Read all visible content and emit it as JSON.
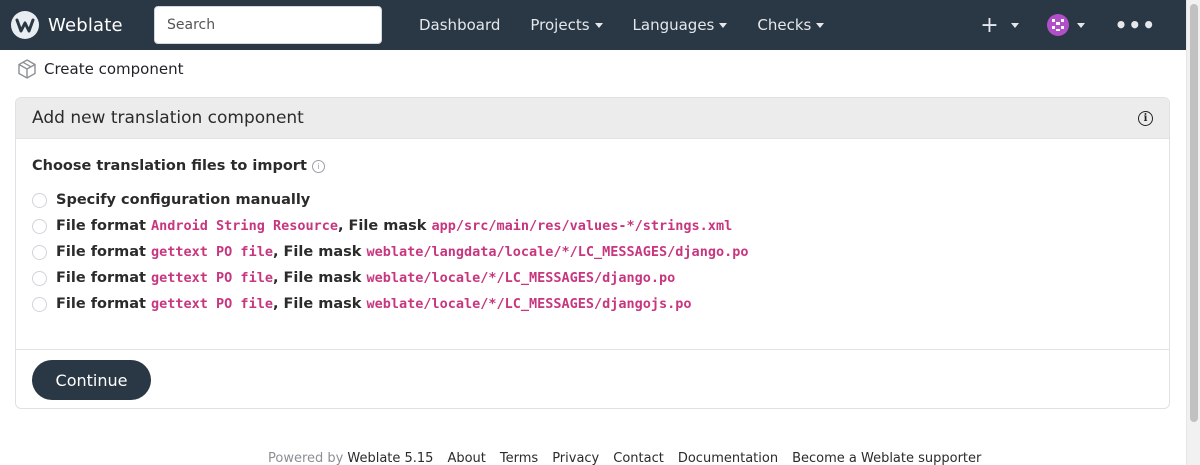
{
  "app": {
    "name": "Weblate"
  },
  "search": {
    "placeholder": "Search"
  },
  "nav": {
    "items": [
      "Dashboard",
      "Projects",
      "Languages",
      "Checks"
    ]
  },
  "navright": {
    "plus": "+",
    "more": "•••"
  },
  "breadcrumb": {
    "label": "Create component"
  },
  "card": {
    "title": "Add new translation component",
    "legend": "Choose translation files to import",
    "options": [
      {
        "plain": "Specify configuration manually"
      },
      {
        "prefix": "File format ",
        "format": "Android String Resource",
        "middle": ", File mask ",
        "mask": "app/src/main/res/values-*/strings.xml"
      },
      {
        "prefix": "File format ",
        "format": "gettext PO file",
        "middle": ", File mask ",
        "mask": "weblate/langdata/locale/*/LC_MESSAGES/django.po"
      },
      {
        "prefix": "File format ",
        "format": "gettext PO file",
        "middle": ", File mask ",
        "mask": "weblate/locale/*/LC_MESSAGES/django.po"
      },
      {
        "prefix": "File format ",
        "format": "gettext PO file",
        "middle": ", File mask ",
        "mask": "weblate/locale/*/LC_MESSAGES/djangojs.po"
      }
    ],
    "continue_label": "Continue"
  },
  "footer": {
    "powered_by": "Powered by",
    "version": "Weblate 5.15",
    "links": [
      "About",
      "Terms",
      "Privacy",
      "Contact",
      "Documentation",
      "Become a Weblate supporter"
    ]
  },
  "colors": {
    "navbar": "#2a3744",
    "code": "#c7367f",
    "avatar": "#b14fc8"
  }
}
